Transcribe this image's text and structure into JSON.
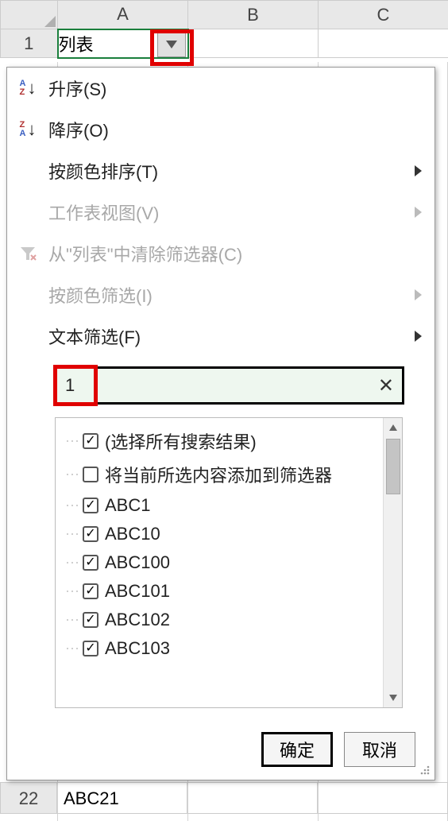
{
  "columns": [
    "A",
    "B",
    "C"
  ],
  "rows": {
    "1": {
      "A": "列表"
    },
    "22": {
      "A": "ABC21"
    }
  },
  "menu": {
    "sort_asc": "升序(S)",
    "sort_desc": "降序(O)",
    "sort_by_color": "按颜色排序(T)",
    "sheet_view": "工作表视图(V)",
    "clear_filter": "从\"列表\"中清除筛选器(C)",
    "filter_by_color": "按颜色筛选(I)",
    "text_filter": "文本筛选(F)"
  },
  "search": {
    "value": "1"
  },
  "list": [
    {
      "label": "(选择所有搜索结果)",
      "checked": true
    },
    {
      "label": "将当前所选内容添加到筛选器",
      "checked": false
    },
    {
      "label": "ABC1",
      "checked": true
    },
    {
      "label": "ABC10",
      "checked": true
    },
    {
      "label": "ABC100",
      "checked": true
    },
    {
      "label": "ABC101",
      "checked": true
    },
    {
      "label": "ABC102",
      "checked": true
    },
    {
      "label": "ABC103",
      "checked": true
    }
  ],
  "buttons": {
    "ok": "确定",
    "cancel": "取消"
  }
}
